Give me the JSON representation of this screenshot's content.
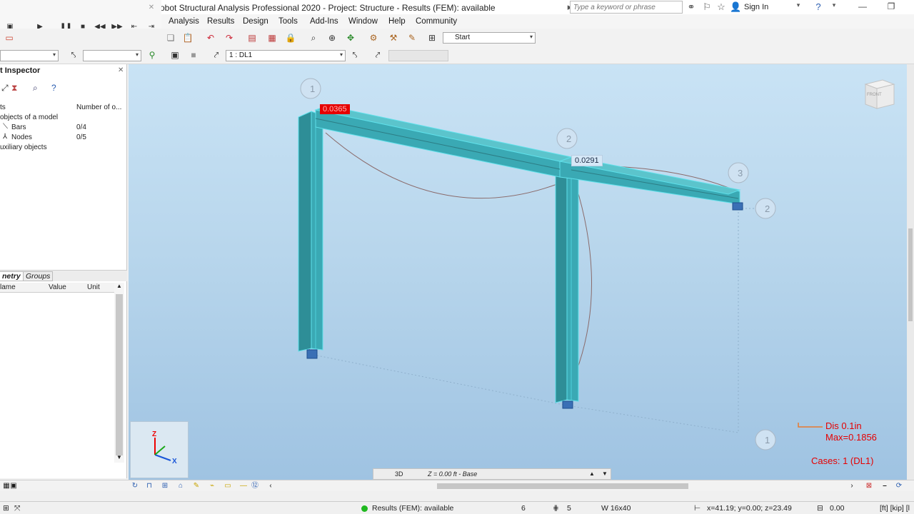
{
  "window": {
    "title": "obot Structural Analysis Professional 2020 - Project: Structure - Results (FEM): available",
    "search_placeholder": "Type a keyword or phrase",
    "sign_in": "Sign In"
  },
  "menu": [
    "Analysis",
    "Results",
    "Design",
    "Tools",
    "Add-Ins",
    "Window",
    "Help",
    "Community"
  ],
  "toolbar": {
    "start_combo": "Start",
    "load_case_combo": "1 : DL1"
  },
  "inspector": {
    "title": "t Inspector",
    "col_number": "Number of o...",
    "tree": [
      {
        "label": "ts",
        "value": ""
      },
      {
        "label": "objects of a model",
        "value": ""
      },
      {
        "label": "Bars",
        "value": "0/4"
      },
      {
        "label": "Nodes",
        "value": "0/5"
      },
      {
        "label": "uxiliary objects",
        "value": ""
      }
    ],
    "tabs": [
      "netry",
      "Groups"
    ],
    "grid_headers": [
      "lame",
      "Value",
      "Unit"
    ]
  },
  "viewport": {
    "value_label_a": "0.0365",
    "value_label_b": "0.0291",
    "node_labels": [
      "1",
      "2",
      "3",
      "2",
      "1"
    ],
    "dis_line1": "Dis  0.1in",
    "dis_line2": "Max=0.1856",
    "cases": "Cases: 1 (DL1)",
    "view_mode": "3D",
    "z_level": "Z = 0.00 ft - Base",
    "cube_face": "FRONT",
    "axis_z": "Z",
    "axis_x": "X"
  },
  "status": {
    "results": "Results (FEM): available",
    "count_a": "6",
    "count_b": "5",
    "section": "W 16x40",
    "coords": "x=41.19; y=0.00; z=23.49",
    "value": "0.00",
    "units": "[ft] [kip] [l"
  },
  "colors": {
    "member_fill": "#3aa9b4",
    "member_highlight": "#5fe0ea",
    "deformation": "#8a5a5a",
    "accent_red": "#e60000"
  }
}
